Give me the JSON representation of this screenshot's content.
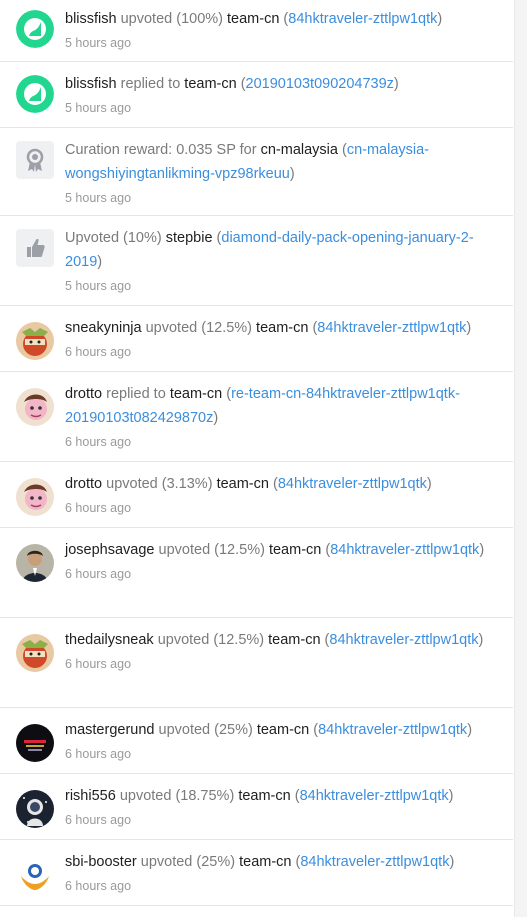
{
  "items": [
    {
      "avatar": "steem-logo-icon",
      "actor": "blissfish",
      "action": "upvoted (100%)",
      "target": "team-cn",
      "link": "84hktraveler-zttlpw1qtk",
      "time": "5 hours ago"
    },
    {
      "avatar": "steem-logo-icon",
      "actor": "blissfish",
      "action": "replied to",
      "target": "team-cn",
      "link": "20190103t090204739z",
      "time": "5 hours ago"
    },
    {
      "avatar": "award-ribbon-icon",
      "action": "Curation reward: 0.035 SP for",
      "target": "cn-malaysia",
      "link": "cn-malaysia-wongshiyingtanlikming-vpz98rkeuu",
      "time": "5 hours ago"
    },
    {
      "avatar": "thumbs-up-icon",
      "action": "Upvoted (10%)",
      "target": "stepbie",
      "link": "diamond-daily-pack-opening-january-2-2019",
      "time": "5 hours ago"
    },
    {
      "avatar": "sneakyninja-avatar",
      "actor": "sneakyninja",
      "action": "upvoted (12.5%)",
      "target": "team-cn",
      "link": "84hktraveler-zttlpw1qtk",
      "time": "6 hours ago"
    },
    {
      "avatar": "drotto-avatar",
      "actor": "drotto",
      "action": "replied to",
      "target": "team-cn",
      "link": "re-team-cn-84hktraveler-zttlpw1qtk-20190103t082429870z",
      "time": "6 hours ago"
    },
    {
      "avatar": "drotto-avatar",
      "actor": "drotto",
      "action": "upvoted (3.13%)",
      "target": "team-cn",
      "link": "84hktraveler-zttlpw1qtk",
      "time": "6 hours ago"
    },
    {
      "avatar": "josephsavage-avatar",
      "actor": "josephsavage",
      "action": "upvoted (12.5%)",
      "target": "team-cn",
      "link": "84hktraveler-zttlpw1qtk",
      "time": "6 hours ago"
    },
    {
      "avatar": "thedailysneak-avatar",
      "actor": "thedailysneak",
      "action": "upvoted (12.5%)",
      "target": "team-cn",
      "link": "84hktraveler-zttlpw1qtk",
      "time": "6 hours ago"
    },
    {
      "avatar": "mastergerund-avatar",
      "actor": "mastergerund",
      "action": "upvoted (25%)",
      "target": "team-cn",
      "link": "84hktraveler-zttlpw1qtk",
      "time": "6 hours ago"
    },
    {
      "avatar": "rishi556-avatar",
      "actor": "rishi556",
      "action": "upvoted (18.75%)",
      "target": "team-cn",
      "link": "84hktraveler-zttlpw1qtk",
      "time": "6 hours ago"
    },
    {
      "avatar": "sbi-booster-avatar",
      "actor": "sbi-booster",
      "action": "upvoted (25%)",
      "target": "team-cn",
      "link": "84hktraveler-zttlpw1qtk",
      "time": "6 hours ago"
    }
  ]
}
